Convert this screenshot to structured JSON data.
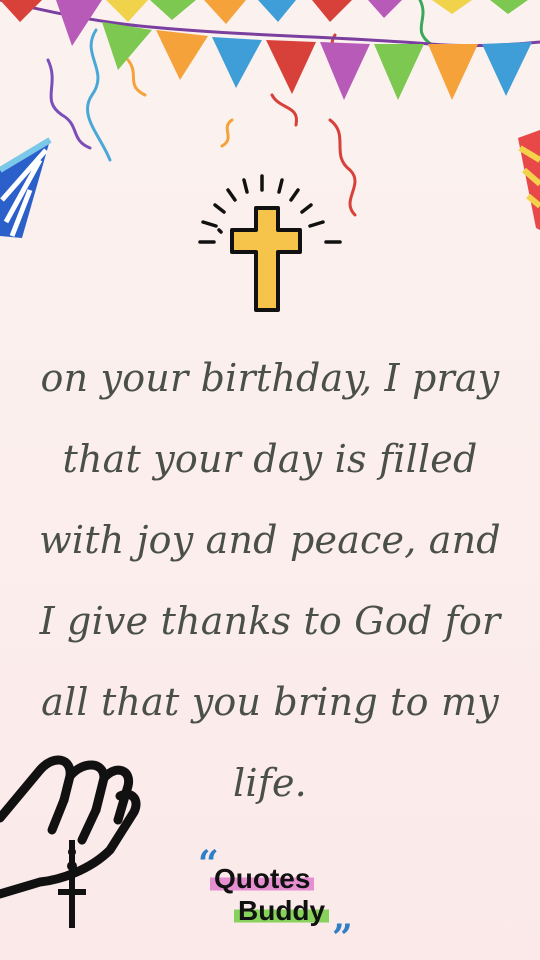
{
  "quote_lines": [
    "on your birthday, I pray",
    "that your day is filled",
    "with joy and peace, and",
    "I give thanks to God for",
    "all that you bring to my",
    "life."
  ],
  "logo": {
    "open_quote": "“",
    "word1": "Quotes",
    "word2": "Buddy",
    "close_quote": "”"
  },
  "icons": [
    "bunting-banner",
    "streamer",
    "party-hat",
    "cross-icon",
    "praying-hands-icon"
  ],
  "colors": {
    "background": "#fbf0ee",
    "text": "#4a4f49",
    "cross": "#f6c34b",
    "logo_pink": "#e58fd0",
    "logo_green": "#86d25a",
    "logo_quote": "#2f7fc7"
  }
}
